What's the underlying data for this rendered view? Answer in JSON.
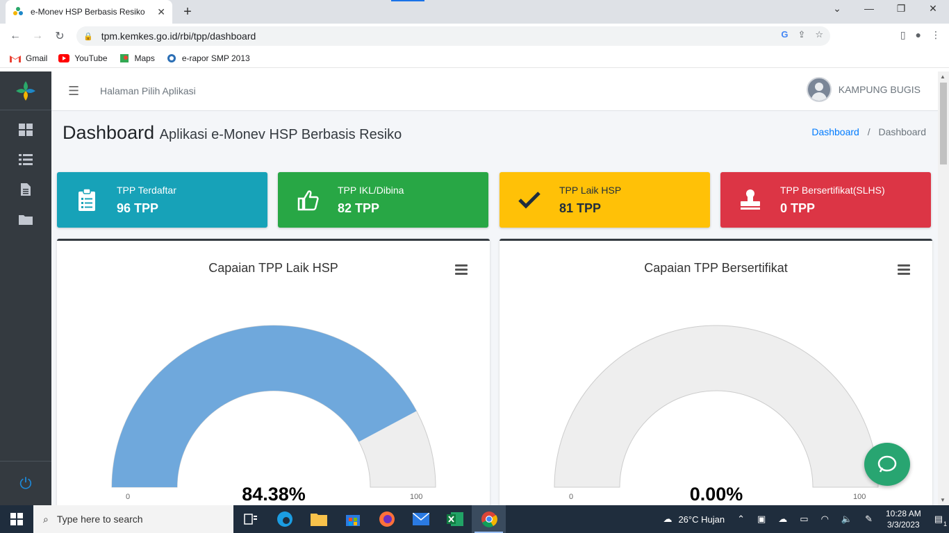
{
  "browser": {
    "tab_title": "e-Monev HSP Berbasis Resiko",
    "url": "tpm.kemkes.go.id/rbi/tpp/dashboard",
    "bookmarks": [
      "Gmail",
      "YouTube",
      "Maps",
      "e-rapor SMP 2013"
    ]
  },
  "topnav": {
    "link": "Halaman Pilih Aplikasi",
    "user": "KAMPUNG BUGIS"
  },
  "page": {
    "title": "Dashboard",
    "subtitle": "Aplikasi e-Monev HSP Berbasis Resiko",
    "breadcrumb": [
      "Dashboard",
      "Dashboard"
    ],
    "breadcrumb_sep": "/"
  },
  "info_boxes": [
    {
      "label": "TPP Terdaftar",
      "value": "96 TPP",
      "color": "#17a2b8",
      "icon": "clipboard-icon"
    },
    {
      "label": "TPP IKL/Dibina",
      "value": "82 TPP",
      "color": "#28a745",
      "icon": "thumbs-up-icon"
    },
    {
      "label": "TPP Laik HSP",
      "value": "81 TPP",
      "color": "#ffc107",
      "icon": "check-icon"
    },
    {
      "label": "TPP Bersertifikat(SLHS)",
      "value": "0 TPP",
      "color": "#dc3545",
      "icon": "stamp-icon"
    }
  ],
  "charts_text": [
    {
      "title": "Capaian TPP Laik HSP",
      "min": "0",
      "max": "100",
      "value_label": "84.38%"
    },
    {
      "title": "Capaian TPP Bersertifikat",
      "min": "0",
      "max": "100",
      "value_label": "0.00%"
    }
  ],
  "chart_data": [
    {
      "type": "gauge",
      "title": "Capaian TPP Laik HSP",
      "min": 0,
      "max": 100,
      "value": 84.38,
      "color": "#6fa8dc",
      "track_color": "#eeeeee"
    },
    {
      "type": "gauge",
      "title": "Capaian TPP Bersertifikat",
      "min": 0,
      "max": 100,
      "value": 0.0,
      "color": "#6fa8dc",
      "track_color": "#eeeeee"
    }
  ],
  "taskbar": {
    "search_placeholder": "Type here to search",
    "weather": "26°C  Hujan",
    "time": "10:28 AM",
    "date": "3/3/2023",
    "notifications": "1"
  }
}
